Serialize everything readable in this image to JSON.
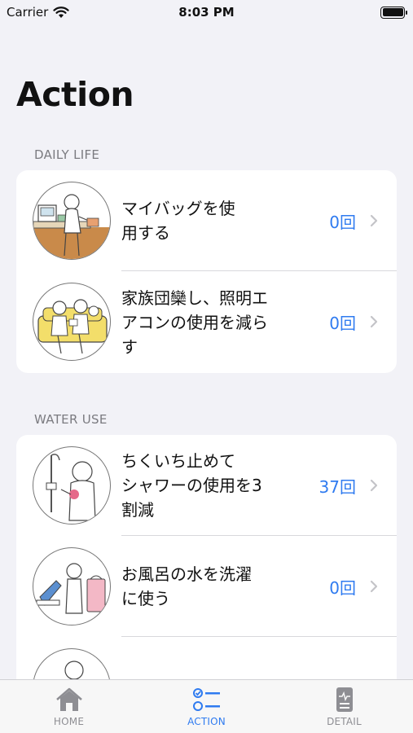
{
  "status_bar": {
    "carrier": "Carrier",
    "time": "8:03 PM"
  },
  "page_title": "Action",
  "sections": [
    {
      "header": "DAILY LIFE",
      "items": [
        {
          "title_lines": [
            "マイバッグを使",
            "用する"
          ],
          "count": "0回",
          "icon": "shopping-illustration-icon"
        },
        {
          "title_lines": [
            "家族団欒し、照明エ",
            "アコンの使用を減ら",
            "す"
          ],
          "count": "0回",
          "icon": "family-sofa-illustration-icon"
        }
      ]
    },
    {
      "header": "WATER USE",
      "items": [
        {
          "title_lines": [
            "ちくいち止めて",
            "シャワーの使用を3",
            "割減"
          ],
          "count": "37回",
          "icon": "shower-illustration-icon"
        },
        {
          "title_lines": [
            "お風呂の水を洗濯",
            "に使う"
          ],
          "count": "0回",
          "icon": "laundry-illustration-icon"
        }
      ]
    }
  ],
  "tab_bar": {
    "tabs": [
      {
        "label": "HOME",
        "icon": "home-icon"
      },
      {
        "label": "ACTION",
        "icon": "action-list-icon"
      },
      {
        "label": "DETAIL",
        "icon": "detail-document-icon"
      }
    ],
    "active": "ACTION"
  },
  "colors": {
    "accent": "#2f7bf0",
    "background": "#F2F2F7",
    "secondary_text": "#7b7b80"
  }
}
